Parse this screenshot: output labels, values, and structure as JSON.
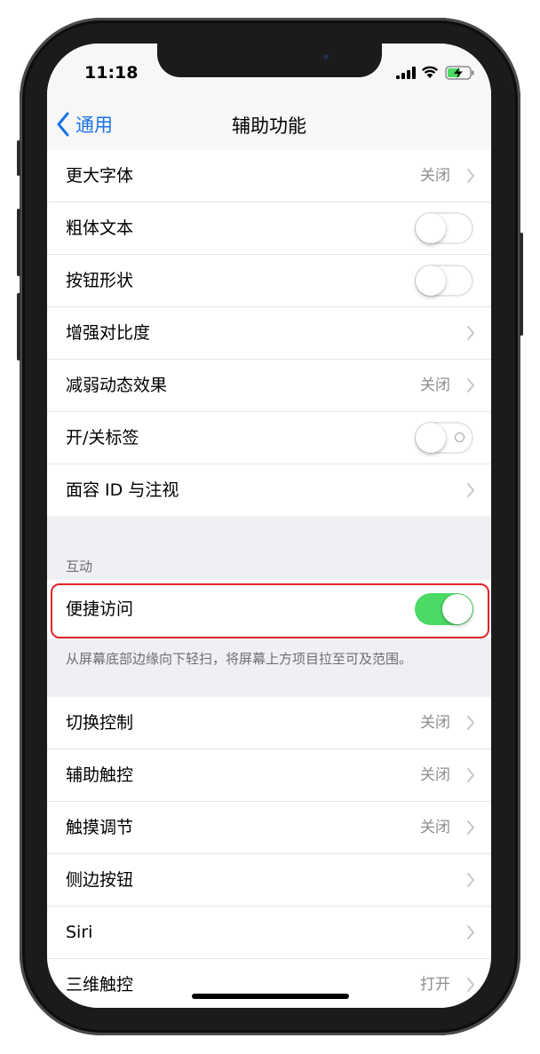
{
  "status_bar": {
    "time": "11:18"
  },
  "nav": {
    "back_label": "通用",
    "title": "辅助功能"
  },
  "group1": {
    "rows": [
      {
        "label": "更大字体",
        "value": "关闭",
        "control": "chevron"
      },
      {
        "label": "粗体文本",
        "control": "toggle",
        "toggle_on": false
      },
      {
        "label": "按钮形状",
        "control": "toggle",
        "toggle_on": false
      },
      {
        "label": "增强对比度",
        "control": "chevron"
      },
      {
        "label": "减弱动态效果",
        "value": "关闭",
        "control": "chevron"
      },
      {
        "label": "开/关标签",
        "control": "toggle",
        "toggle_on": false
      },
      {
        "label": "面容 ID 与注视",
        "control": "chevron"
      }
    ]
  },
  "interaction": {
    "header": "互动",
    "reachability": {
      "label": "便捷访问",
      "toggle_on": true
    },
    "footer": "从屏幕底部边缘向下轻扫，将屏幕上方项目拉至可及范围。"
  },
  "group3": {
    "rows": [
      {
        "label": "切换控制",
        "value": "关闭",
        "control": "chevron"
      },
      {
        "label": "辅助触控",
        "value": "关闭",
        "control": "chevron"
      },
      {
        "label": "触摸调节",
        "value": "关闭",
        "control": "chevron"
      },
      {
        "label": "侧边按钮",
        "control": "chevron"
      },
      {
        "label": "Siri",
        "control": "chevron"
      },
      {
        "label": "三维触控",
        "value": "打开",
        "control": "chevron"
      }
    ]
  },
  "colors": {
    "accent": "#1a73e8",
    "toggle_on": "#4cd964",
    "highlight": "#e0242b"
  }
}
